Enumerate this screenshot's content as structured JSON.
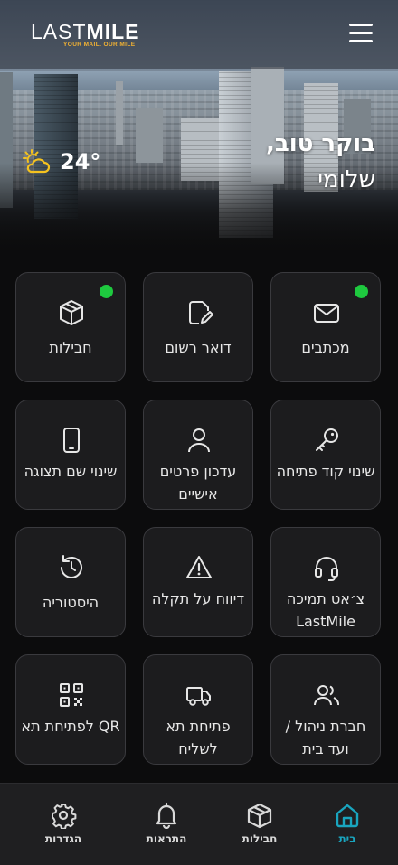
{
  "header": {
    "logo_text_light": "LAST",
    "logo_text_bold": "MILE",
    "logo_tagline": "YOUR MAIL. OUR MILE",
    "greeting_line1": "בוקר טוב,",
    "greeting_name": "שלומי",
    "weather_temp": "24°",
    "weather_icon": "partly-cloudy-sun-icon"
  },
  "tiles": [
    {
      "label": "מכתבים",
      "icon": "envelope-icon",
      "notification": true
    },
    {
      "label": "דואר רשום",
      "icon": "signed-document-icon",
      "notification": false
    },
    {
      "label": "חבילות",
      "icon": "package-icon",
      "notification": true
    },
    {
      "label": "שינוי קוד פתיחה",
      "icon": "key-icon",
      "notification": false
    },
    {
      "label": "עדכון פרטים אישיים",
      "icon": "user-icon",
      "notification": false
    },
    {
      "label": "שינוי שם תצוגה",
      "icon": "display-device-icon",
      "notification": false
    },
    {
      "label": "צ׳אט תמיכה LastMile",
      "icon": "headset-icon",
      "notification": false
    },
    {
      "label": "דיווח על תקלה",
      "icon": "warning-icon",
      "notification": false
    },
    {
      "label": "היסטוריה",
      "icon": "history-icon",
      "notification": false
    },
    {
      "label": "חברת ניהול / ועד בית",
      "icon": "users-icon",
      "notification": false
    },
    {
      "label": "פתיחת תא לשליח",
      "icon": "delivery-truck-icon",
      "notification": false
    },
    {
      "label": "QR לפתיחת תא",
      "icon": "qr-code-icon",
      "notification": false
    }
  ],
  "nav": [
    {
      "label": "בית",
      "icon": "home-icon",
      "active": true
    },
    {
      "label": "חבילות",
      "icon": "package-icon",
      "active": false
    },
    {
      "label": "התראות",
      "icon": "bell-icon",
      "active": false
    },
    {
      "label": "הגדרות",
      "icon": "gear-icon",
      "active": false
    }
  ],
  "colors": {
    "accent": "#19a5bf",
    "notification": "#1ec93f",
    "tile_bg": "#1c1c1e",
    "brand_yellow": "#f2b233"
  }
}
